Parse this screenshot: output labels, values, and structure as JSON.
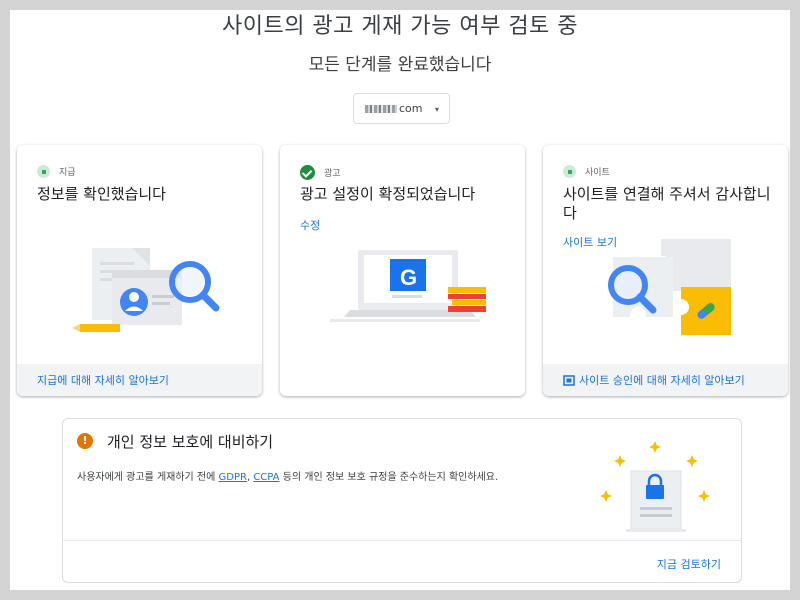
{
  "header": {
    "title": "사이트의 광고 게재 가능 여부 검토 중",
    "subtitle": "모든 단계를 완료했습니다",
    "site_selector": {
      "value": "com",
      "caret": "▾"
    }
  },
  "cards": [
    {
      "status_label": "지급",
      "status_icon": "green-dot-icon",
      "title": "정보를 확인했습니다",
      "footer_link": "지급에 대해 자세히 알아보기"
    },
    {
      "status_label": "광고",
      "status_icon": "checkmark-icon",
      "title": "광고 설정이 확정되었습니다",
      "action_link": "수정"
    },
    {
      "status_label": "사이트",
      "status_icon": "green-dot-icon",
      "title": "사이트를 연결해 주셔서 감사합니다",
      "action_link": "사이트 보기",
      "footer_link": "사이트 승인에 대해 자세히 알아보기",
      "footer_icon": "open-in-new-icon"
    }
  ],
  "privacy": {
    "warning_icon": "!",
    "title": "개인 정보 보호에 대비하기",
    "desc_prefix": "사용자에게 광고를 게재하기 전에 ",
    "gdpr": "GDPR",
    "comma": ", ",
    "ccpa": "CCPA",
    "desc_suffix": " 등의 개인 정보 보호 규정을 준수하는지 확인하세요.",
    "review_button": "지금 검토하기"
  },
  "colors": {
    "accent": "#1a73e8",
    "success": "#1e8e3e",
    "warning": "#e37400",
    "star": "#fbbc04"
  }
}
